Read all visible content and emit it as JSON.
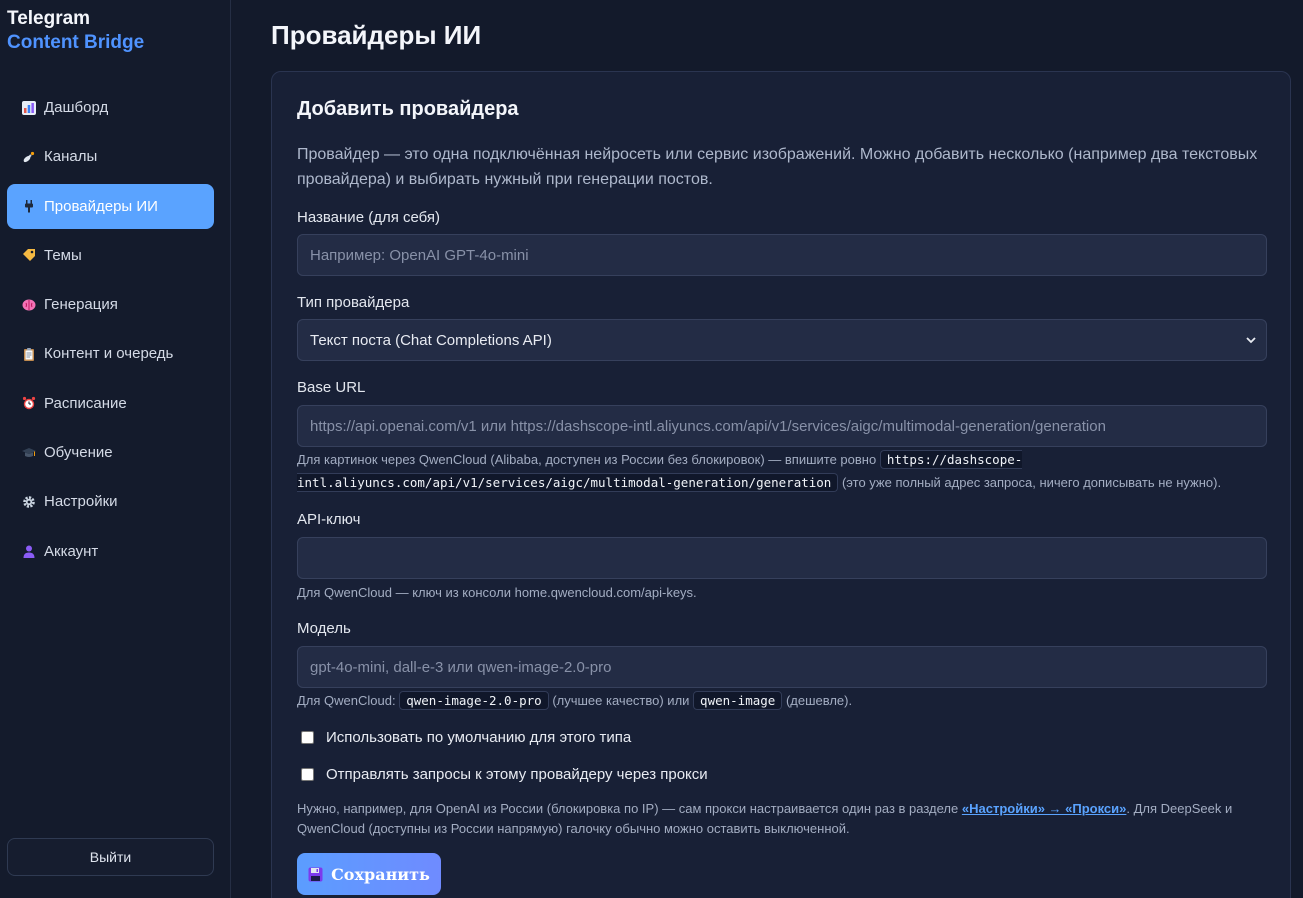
{
  "brand": {
    "line1": "Telegram",
    "line2": "Content Bridge"
  },
  "sidebar": {
    "items": [
      {
        "label": "Дашборд",
        "icon": "chart-icon"
      },
      {
        "label": "Каналы",
        "icon": "satellite-icon"
      },
      {
        "label": "Провайдеры ИИ",
        "icon": "plug-icon",
        "active": true
      },
      {
        "label": "Темы",
        "icon": "tag-icon"
      },
      {
        "label": "Генерация",
        "icon": "brain-icon"
      },
      {
        "label": "Контент и очередь",
        "icon": "clipboard-icon"
      },
      {
        "label": "Расписание",
        "icon": "alarm-clock-icon"
      },
      {
        "label": "Обучение",
        "icon": "graduation-cap-icon"
      },
      {
        "label": "Настройки",
        "icon": "gear-icon"
      },
      {
        "label": "Аккаунт",
        "icon": "user-icon"
      }
    ],
    "logout_label": "Выйти"
  },
  "page": {
    "title": "Провайдеры ИИ"
  },
  "form": {
    "title": "Добавить провайдера",
    "description": "Провайдер — это одна подключённая нейросеть или сервис изображений. Можно добавить несколько (например два текстовых провайдера) и выбирать нужный при генерации постов.",
    "name": {
      "label": "Название (для себя)",
      "placeholder": "Например: OpenAI GPT-4o-mini"
    },
    "type": {
      "label": "Тип провайдера",
      "value": "Текст поста (Chat Completions API)"
    },
    "base_url": {
      "label": "Base URL",
      "placeholder": "https://api.openai.com/v1 или https://dashscope-intl.aliyuncs.com/api/v1/services/aigc/multimodal-generation/generation",
      "hint_before": "Для картинок через QwenCloud (Alibaba, доступен из России без блокировок) — впишите ровно",
      "hint_code": "https://dashscope-intl.aliyuncs.com/api/v1/services/aigc/multimodal-generation/generation",
      "hint_after": "(это уже полный адрес запроса, ничего дописывать не нужно)."
    },
    "api_key": {
      "label": "API-ключ",
      "value": "",
      "hint": "Для QwenCloud — ключ из консоли home.qwencloud.com/api-keys."
    },
    "model": {
      "label": "Модель",
      "placeholder": "gpt-4o-mini, dall-e-3 или qwen-image-2.0-pro",
      "hint_prefix": "Для QwenCloud:",
      "hint_code1": "qwen-image-2.0-pro",
      "hint_mid": "(лучшее качество) или",
      "hint_code2": "qwen-image",
      "hint_suffix": "(дешевле)."
    },
    "default_checkbox": {
      "label": "Использовать по умолчанию для этого типа",
      "checked": false
    },
    "proxy_checkbox": {
      "label": "Отправлять запросы к этому провайдеру через прокси",
      "checked": false
    },
    "proxy_hint": {
      "before": "Нужно, например, для OpenAI из России (блокировка по IP) — сам прокси настраивается один раз в разделе",
      "link": "«Настройки» → «Прокси»",
      "after": ". Для DeepSeek и QwenCloud (доступны из России напрямую) галочку обычно можно оставить выключенной."
    },
    "save_label": "Сохранить"
  },
  "colors": {
    "accent": "#5aa3ff",
    "brand_blue": "#4f93ff",
    "background": "#131a2b"
  }
}
